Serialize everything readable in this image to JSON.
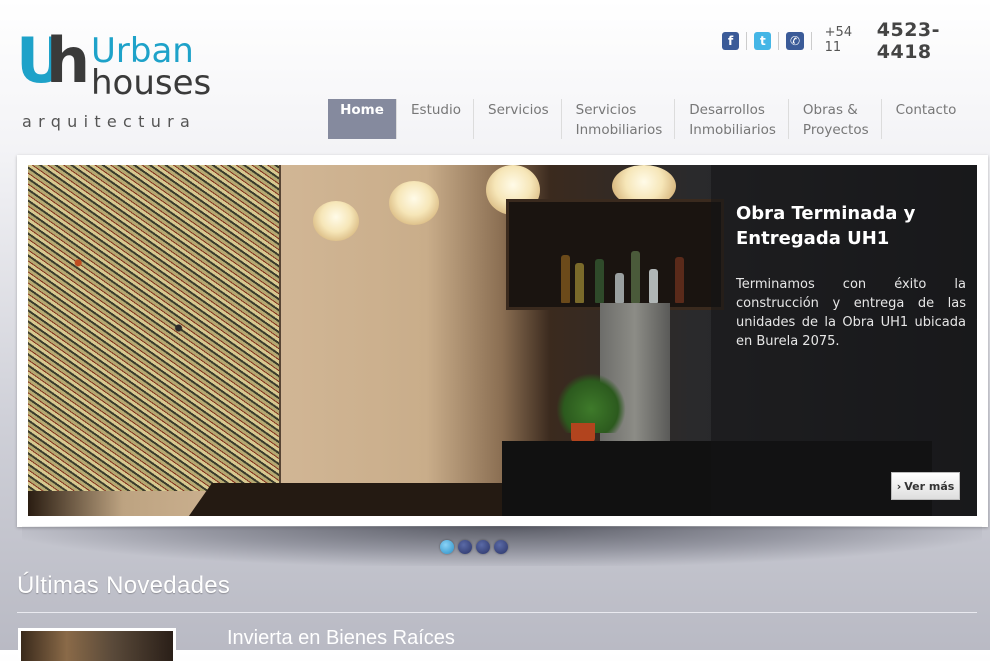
{
  "logo": {
    "mark_u": "U",
    "mark_h": "h",
    "word1": "Urban",
    "word2": "houses",
    "tagline": "arquitectura"
  },
  "header": {
    "social": [
      {
        "name": "facebook-icon",
        "glyph": "f"
      },
      {
        "name": "twitter-icon",
        "glyph": "t"
      },
      {
        "name": "phone-icon",
        "glyph": "✆"
      }
    ],
    "phone_prefix": "+54 11",
    "phone_number": "4523-4418"
  },
  "nav": {
    "items": [
      {
        "label": "Home",
        "active": true
      },
      {
        "label": "Estudio"
      },
      {
        "label": "Servicios"
      },
      {
        "label": "Servicios\nInmobiliarios"
      },
      {
        "label": "Desarrollos\nInmobiliarios"
      },
      {
        "label": "Obras &\nProyectos"
      },
      {
        "label": "Contacto"
      }
    ]
  },
  "slider": {
    "caption_title": "Obra Terminada y Entregada UH1",
    "caption_text": "Terminamos con éxito la construcción y entrega de las unidades de la Obra UH1 ubicada en Burela 2075.",
    "button_arrow": "›",
    "button_label": "Ver más",
    "slide_count": 4,
    "active_slide": 1
  },
  "news": {
    "section_title": "Últimas Novedades",
    "first_item_title": "Invierta en Bienes Raíces"
  }
}
